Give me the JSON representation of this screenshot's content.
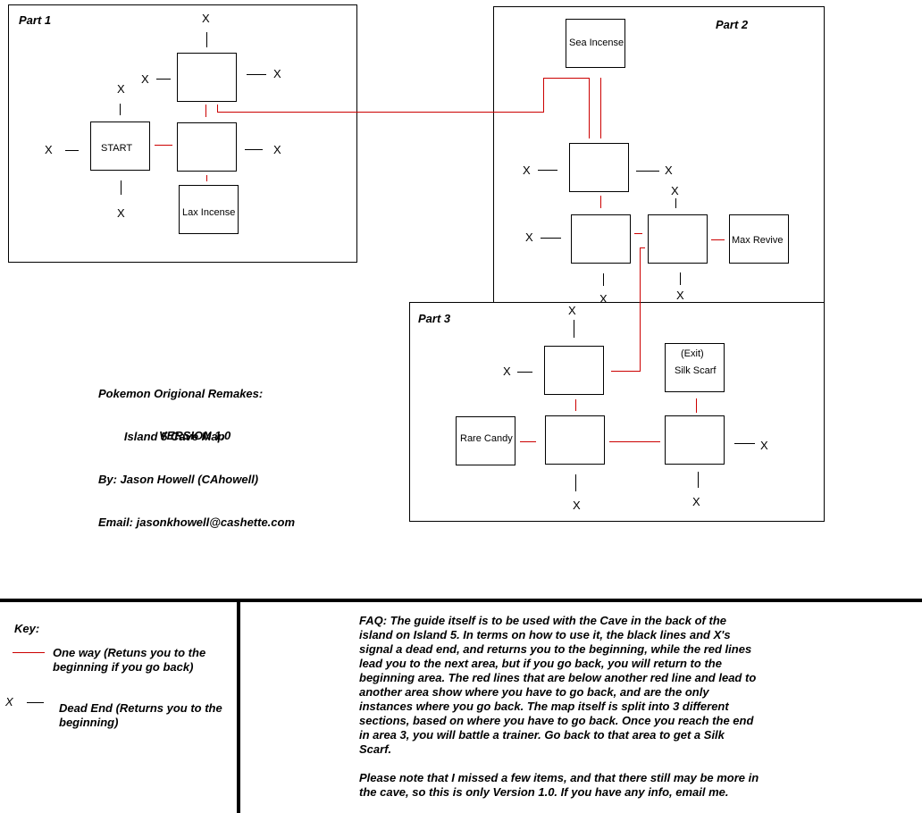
{
  "colors": {
    "one_way": "#cc0000",
    "dead_end": "#000000",
    "background": "#ffffff"
  },
  "parts": [
    {
      "label": "Part 1"
    },
    {
      "label": "Part 2"
    },
    {
      "label": "Part 3"
    }
  ],
  "rooms": {
    "start": "START",
    "lax_incense": "Lax Incense",
    "sea_incense": "Sea Incense",
    "max_revive": "Max Revive",
    "exit_label": "(Exit)",
    "silk_scarf": "Silk Scarf",
    "rare_candy": "Rare Candy"
  },
  "dead_end_marker": "X",
  "credits": {
    "title": "Pokemon Origional Remakes:",
    "subtitle": "        Island 5 Cave Map",
    "author": "By: Jason Howell (CAhowell)",
    "email": "Email: jasonkhowell@cashette.com",
    "version": "VERSION 1.0"
  },
  "key": {
    "title": "Key:",
    "one_way_line1": "One way (Retuns you to the",
    "one_way_line2": "beginning if you go back)",
    "dead_end_marker": "X",
    "dead_end_line1": "Dead End (Returns you to the",
    "dead_end_line2": "beginning)"
  },
  "faq": {
    "para1_lines": [
      "FAQ: The guide itself is to be used with the Cave in the back of the",
      "island on Island 5. In terms on how to use it, the black lines and X's",
      "signal a dead end, and returns you to the beginning, while the red lines",
      "lead you to the next area, but if you go back, you will return to the",
      "beginning area. The red lines that are below another red line and lead to",
      "another area show where you have to go back, and are the only",
      "instances where you go back. The map itself is split into 3 different",
      "sections, based on where you have to go back. Once you reach the end",
      "in area 3, you will battle a trainer. Go back to that area to get a Silk",
      "Scarf."
    ],
    "para2_lines": [
      "Please note that I missed a few items, and that there still may be more in",
      "the cave, so this is only Version 1.0. If you have any info, email me."
    ]
  }
}
